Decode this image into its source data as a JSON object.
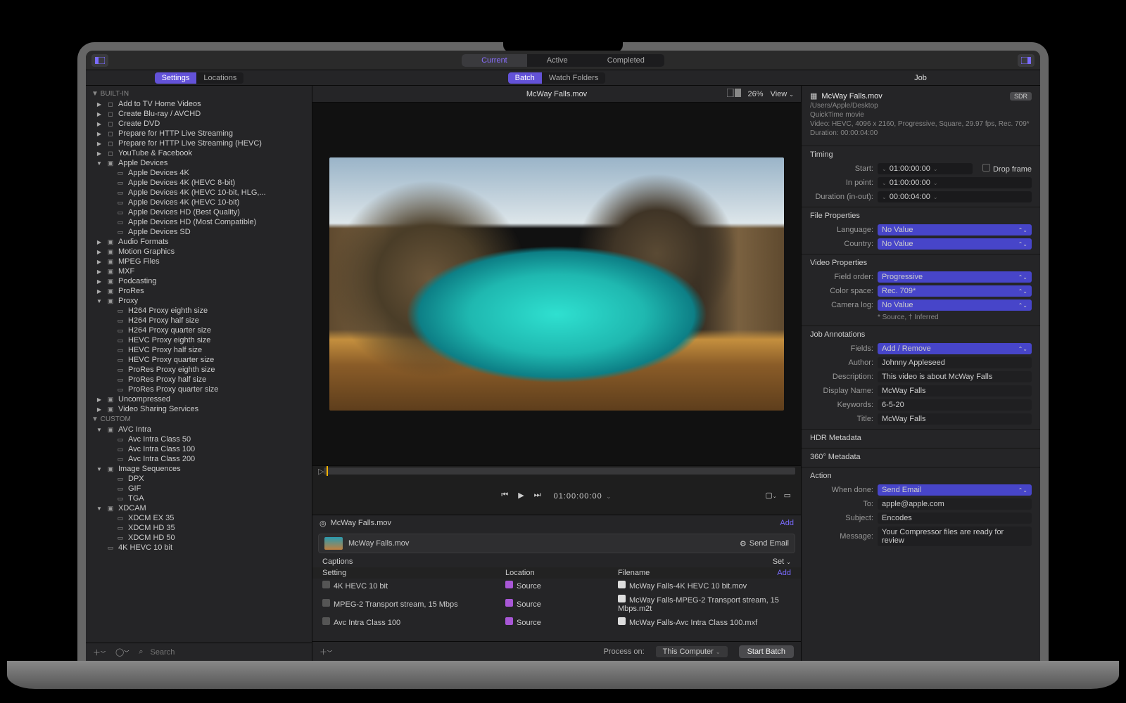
{
  "toolbar": {
    "tabs": [
      "Current",
      "Active",
      "Completed"
    ],
    "active": 0
  },
  "subbar": {
    "left": [
      "Settings",
      "Locations"
    ],
    "left_active": 0,
    "center": [
      "Batch",
      "Watch Folders"
    ],
    "center_active": 0,
    "right": "Job"
  },
  "tree": {
    "headers": [
      "BUILT-IN",
      "CUSTOM"
    ],
    "builtins": [
      {
        "label": "Add to TV Home Videos",
        "icon": "box",
        "indent": 1,
        "disclosure": "▶"
      },
      {
        "label": "Create Blu-ray / AVCHD",
        "icon": "box",
        "indent": 1,
        "disclosure": "▶"
      },
      {
        "label": "Create DVD",
        "icon": "box",
        "indent": 1,
        "disclosure": "▶"
      },
      {
        "label": "Prepare for HTTP Live Streaming",
        "icon": "box",
        "indent": 1,
        "disclosure": "▶"
      },
      {
        "label": "Prepare for HTTP Live Streaming (HEVC)",
        "icon": "box",
        "indent": 1,
        "disclosure": "▶"
      },
      {
        "label": "YouTube & Facebook",
        "icon": "box",
        "indent": 1,
        "disclosure": "▶"
      },
      {
        "label": "Apple Devices",
        "icon": "folder",
        "indent": 1,
        "disclosure": "▼"
      },
      {
        "label": "Apple Devices 4K",
        "icon": "doc",
        "indent": 2
      },
      {
        "label": "Apple Devices 4K (HEVC 8-bit)",
        "icon": "doc",
        "indent": 2
      },
      {
        "label": "Apple Devices 4K (HEVC 10-bit, HLG,...",
        "icon": "doc",
        "indent": 2
      },
      {
        "label": "Apple Devices 4K (HEVC 10-bit)",
        "icon": "doc",
        "indent": 2
      },
      {
        "label": "Apple Devices HD (Best Quality)",
        "icon": "doc",
        "indent": 2
      },
      {
        "label": "Apple Devices HD (Most Compatible)",
        "icon": "doc",
        "indent": 2
      },
      {
        "label": "Apple Devices SD",
        "icon": "doc",
        "indent": 2
      },
      {
        "label": "Audio Formats",
        "icon": "folder",
        "indent": 1,
        "disclosure": "▶"
      },
      {
        "label": "Motion Graphics",
        "icon": "folder",
        "indent": 1,
        "disclosure": "▶"
      },
      {
        "label": "MPEG Files",
        "icon": "folder",
        "indent": 1,
        "disclosure": "▶"
      },
      {
        "label": "MXF",
        "icon": "folder",
        "indent": 1,
        "disclosure": "▶"
      },
      {
        "label": "Podcasting",
        "icon": "folder",
        "indent": 1,
        "disclosure": "▶"
      },
      {
        "label": "ProRes",
        "icon": "folder",
        "indent": 1,
        "disclosure": "▶"
      },
      {
        "label": "Proxy",
        "icon": "folder",
        "indent": 1,
        "disclosure": "▼"
      },
      {
        "label": "H264 Proxy eighth size",
        "icon": "doc",
        "indent": 2
      },
      {
        "label": "H264 Proxy half size",
        "icon": "doc",
        "indent": 2
      },
      {
        "label": "H264 Proxy quarter size",
        "icon": "doc",
        "indent": 2
      },
      {
        "label": "HEVC Proxy eighth size",
        "icon": "doc",
        "indent": 2
      },
      {
        "label": "HEVC Proxy half size",
        "icon": "doc",
        "indent": 2
      },
      {
        "label": "HEVC Proxy quarter size",
        "icon": "doc",
        "indent": 2
      },
      {
        "label": "ProRes Proxy eighth size",
        "icon": "doc",
        "indent": 2
      },
      {
        "label": "ProRes Proxy half size",
        "icon": "doc",
        "indent": 2
      },
      {
        "label": "ProRes Proxy quarter size",
        "icon": "doc",
        "indent": 2
      },
      {
        "label": "Uncompressed",
        "icon": "folder",
        "indent": 1,
        "disclosure": "▶"
      },
      {
        "label": "Video Sharing Services",
        "icon": "folder",
        "indent": 1,
        "disclosure": "▶"
      }
    ],
    "customs": [
      {
        "label": "AVC Intra",
        "icon": "folder",
        "indent": 1,
        "disclosure": "▼"
      },
      {
        "label": "Avc Intra Class 50",
        "icon": "doc",
        "indent": 2
      },
      {
        "label": "Avc Intra Class 100",
        "icon": "doc",
        "indent": 2
      },
      {
        "label": "Avc Intra Class 200",
        "icon": "doc",
        "indent": 2
      },
      {
        "label": "Image Sequences",
        "icon": "folder",
        "indent": 1,
        "disclosure": "▼"
      },
      {
        "label": "DPX",
        "icon": "doc",
        "indent": 2
      },
      {
        "label": "GIF",
        "icon": "doc",
        "indent": 2
      },
      {
        "label": "TGA",
        "icon": "doc",
        "indent": 2
      },
      {
        "label": "XDCAM",
        "icon": "folder",
        "indent": 1,
        "disclosure": "▼"
      },
      {
        "label": "XDCM EX 35",
        "icon": "doc",
        "indent": 2
      },
      {
        "label": "XDCM HD 35",
        "icon": "doc",
        "indent": 2
      },
      {
        "label": "XDCM HD 50",
        "icon": "doc",
        "indent": 2
      },
      {
        "label": "4K HEVC 10 bit",
        "icon": "doc",
        "indent": 1
      }
    ]
  },
  "search_placeholder": "Search",
  "preview": {
    "title": "McWay Falls.mov",
    "zoom": "26%",
    "view": "View"
  },
  "transport": {
    "timecode": "01:00:00:00"
  },
  "batch": {
    "file": "McWay Falls.mov",
    "add": "Add",
    "job_action": "Send Email",
    "captions": "Captions",
    "set": "Set",
    "cols": [
      "Setting",
      "Location",
      "Filename"
    ],
    "col_add": "Add",
    "rows": [
      {
        "setting": "4K HEVC 10 bit",
        "location": "Source",
        "filename": "McWay Falls-4K HEVC 10 bit.mov"
      },
      {
        "setting": "MPEG-2 Transport stream, 15 Mbps",
        "location": "Source",
        "filename": "McWay Falls-MPEG-2 Transport stream, 15 Mbps.m2t"
      },
      {
        "setting": "Avc Intra Class 100",
        "location": "Source",
        "filename": "McWay Falls-Avc Intra Class 100.mxf"
      }
    ]
  },
  "footer": {
    "process_on": "Process on:",
    "computer": "This Computer",
    "start": "Start Batch"
  },
  "inspector": {
    "filename": "McWay Falls.mov",
    "path": "/Users/Apple/Desktop",
    "kind": "QuickTime movie",
    "video": "Video: HEVC, 4096 x 2160, Progressive, Square, 29.97 fps, Rec. 709*",
    "duration": "Duration: 00:00:04:00",
    "sdr": "SDR",
    "timing": {
      "hdr": "Timing",
      "start_k": "Start:",
      "start_v": "01:00:00:00",
      "in_k": "In point:",
      "in_v": "01:00:00:00",
      "dur_k": "Duration (in-out):",
      "dur_v": "00:00:04:00",
      "drop": "Drop frame"
    },
    "fileprops": {
      "hdr": "File Properties",
      "lang_k": "Language:",
      "lang_v": "No Value",
      "country_k": "Country:",
      "country_v": "No Value"
    },
    "videoprops": {
      "hdr": "Video Properties",
      "field_k": "Field order:",
      "field_v": "Progressive",
      "cs_k": "Color space:",
      "cs_v": "Rec. 709*",
      "cam_k": "Camera log:",
      "cam_v": "No Value",
      "note": "* Source, † Inferred"
    },
    "annotations": {
      "hdr": "Job Annotations",
      "fields_k": "Fields:",
      "fields_v": "Add / Remove",
      "author_k": "Author:",
      "author_v": "Johnny Appleseed",
      "desc_k": "Description:",
      "desc_v": "This video is about McWay Falls",
      "disp_k": "Display Name:",
      "disp_v": "McWay Falls",
      "kw_k": "Keywords:",
      "kw_v": "6-5-20",
      "title_k": "Title:",
      "title_v": "McWay Falls"
    },
    "hdr_meta": "HDR Metadata",
    "meta360": "360° Metadata",
    "action": {
      "hdr": "Action",
      "when_k": "When done:",
      "when_v": "Send Email",
      "to_k": "To:",
      "to_v": "apple@apple.com",
      "subj_k": "Subject:",
      "subj_v": "Encodes",
      "msg_k": "Message:",
      "msg_v": "Your Compressor files are ready for review"
    }
  }
}
